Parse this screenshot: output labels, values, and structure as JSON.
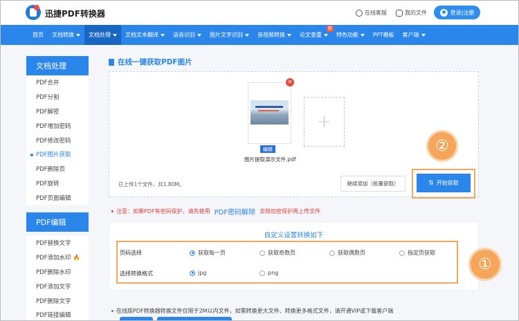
{
  "header": {
    "brand": "迅捷PDF转换器",
    "service_label": "在线客服",
    "files_label": "我的文件",
    "login_label": "登录|注册"
  },
  "nav": {
    "items": [
      {
        "label": "首页",
        "caret": false
      },
      {
        "label": "文档转换",
        "caret": true
      },
      {
        "label": "文档处理",
        "caret": true,
        "active": true
      },
      {
        "label": "文档文本翻译",
        "caret": true
      },
      {
        "label": "语音识别",
        "caret": true
      },
      {
        "label": "图片文字识别",
        "caret": true
      },
      {
        "label": "音视频转换",
        "caret": true
      },
      {
        "label": "论文查重",
        "caret": true,
        "badge": "新"
      },
      {
        "label": "特色功能",
        "caret": true
      },
      {
        "label": "PPT模板",
        "caret": false
      },
      {
        "label": "客户端",
        "caret": true
      }
    ]
  },
  "sidebar": {
    "section1_title": "文档处理",
    "section1_items": [
      "PDF合并",
      "PDF分割",
      "PDF解密",
      "PDF增加密码",
      "PDF修改密码",
      "PDF图片获取",
      "PDF删除页",
      "PDF旋转",
      "PDF页面编辑"
    ],
    "active_item": "PDF图片获取",
    "section2_title": "PDF编辑",
    "section2_items": [
      "PDF替换文字",
      "PDF添加水印",
      "PDF删除水印",
      "PDF添加文字",
      "PDF删除文字",
      "PDF链接编辑"
    ],
    "hot_item": "PDF添加水印"
  },
  "main": {
    "title": "在线一键获取PDF图片",
    "file": {
      "name": "图片提取演示文件.pdf",
      "edit_label": "编辑",
      "thumb_text": "生 态 白 山  城 和 揭 秘"
    },
    "upload_info": "已上传1个文件，共1.80M。",
    "continue_label": "继续添加（批量获取）",
    "start_label": "开始获取",
    "step2_marker": "②",
    "notice_prefix": "注意：如果PDF有密码保护，请先使用",
    "notice_link": "PDF密码解除",
    "notice_suffix": "去除加密保护再上传文件"
  },
  "settings": {
    "title": "自定义设置转换如下",
    "page_label": "页码选择",
    "page_options": [
      "获取每一页",
      "获取奇数页",
      "获取偶数页",
      "指定页获取"
    ],
    "page_selected": "获取每一页",
    "format_label": "选择转换格式",
    "format_options": [
      "jpg",
      "png"
    ],
    "format_selected": "jpg",
    "step1_marker": "①"
  },
  "footer": {
    "note": "在线版PDF转换器转换文件仅限于2M以内文件，如需转换更大文件、转换更多格式文件，请开通VIP或下载客户端"
  },
  "colors": {
    "primary": "#2a86ea",
    "accent_orange": "#f5a65b",
    "warning_red": "#e23c3c"
  }
}
